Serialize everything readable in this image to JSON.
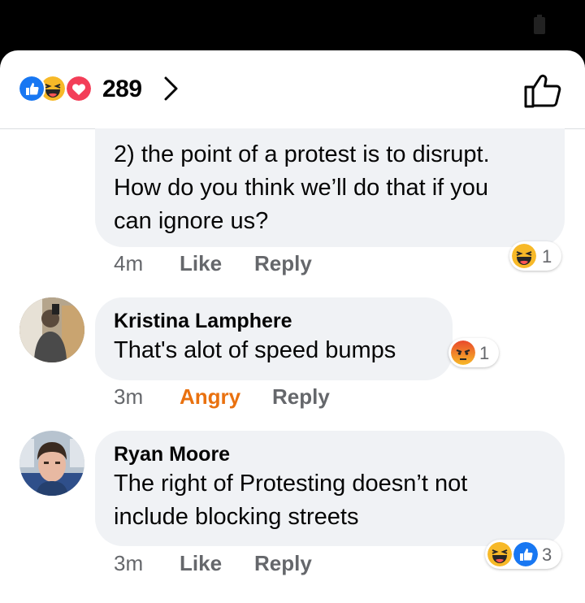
{
  "header": {
    "reaction_count": "289",
    "reactions": [
      "like-icon",
      "haha-icon",
      "love-icon"
    ]
  },
  "comments": [
    {
      "author": "",
      "text_lines": [
        "2) the point of a protest is to disrupt.",
        "How do you think we’ll do that if you",
        "can ignore us?"
      ],
      "time": "4m",
      "action": "Like",
      "reply": "Reply",
      "reaction_badge": {
        "icons": [
          "haha-icon"
        ],
        "count": "1"
      }
    },
    {
      "author": "Kristina Lamphere",
      "text_lines": [
        "That's alot of speed bumps"
      ],
      "time": "3m",
      "action": "Angry",
      "reply": "Reply",
      "reaction_badge": {
        "icons": [
          "angry-icon"
        ],
        "count": "1"
      }
    },
    {
      "author": "Ryan Moore",
      "text_lines": [
        "The right of Protesting doesn’t not",
        "include blocking streets"
      ],
      "time": "3m",
      "action": "Like",
      "reply": "Reply",
      "reaction_badge": {
        "icons": [
          "haha-icon",
          "like-icon"
        ],
        "count": "3"
      }
    }
  ],
  "colors": {
    "like_blue": "#1877f2",
    "love_red": "#f33e58",
    "haha_yellow": "#f7b928",
    "angry_orange": "#e9710f",
    "bubble_gray": "#f0f2f5",
    "meta_gray": "#65676b"
  }
}
